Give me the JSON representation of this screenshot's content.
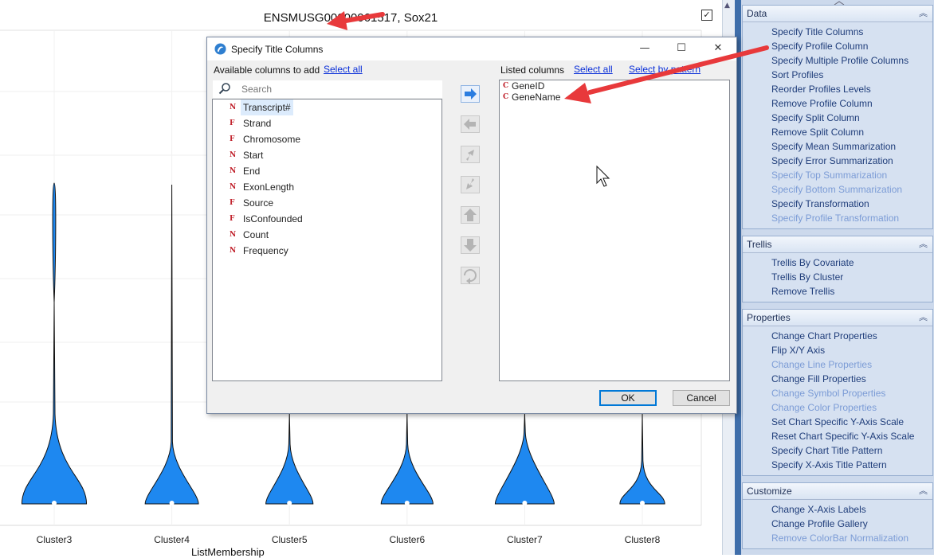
{
  "chart": {
    "title": "ENSMUSG00000061517, Sox21",
    "x_axis_label": "ListMembership",
    "checkbox_mark": "✓"
  },
  "chart_data": {
    "type": "violin",
    "title": "ENSMUSG00000061517, Sox21",
    "xlabel": "ListMembership",
    "categories": [
      "Cluster3",
      "Cluster4",
      "Cluster5",
      "Cluster6",
      "Cluster7",
      "Cluster8"
    ],
    "series": [
      {
        "values": [
          0.62,
          0.38,
          0.25,
          0.35,
          0.5,
          0.2
        ]
      }
    ],
    "fill_color": "#1e88f0",
    "grid": true
  },
  "dialog": {
    "title": "Specify Title Columns",
    "available_label": "Available columns to add",
    "available_select_all": "Select all",
    "listed_label": "Listed columns",
    "listed_select_all": "Select all",
    "listed_select_by_pattern": "Select by pattern",
    "search_placeholder": "Search",
    "available_columns": [
      {
        "type": "N",
        "name": "Transcript#"
      },
      {
        "type": "F",
        "name": "Strand"
      },
      {
        "type": "F",
        "name": "Chromosome"
      },
      {
        "type": "N",
        "name": "Start"
      },
      {
        "type": "N",
        "name": "End"
      },
      {
        "type": "N",
        "name": "ExonLength"
      },
      {
        "type": "F",
        "name": "Source"
      },
      {
        "type": "F",
        "name": "IsConfounded"
      },
      {
        "type": "N",
        "name": "Count"
      },
      {
        "type": "N",
        "name": "Frequency"
      }
    ],
    "listed_columns": [
      {
        "type": "C",
        "name": "GeneID"
      },
      {
        "type": "C",
        "name": "GeneName"
      }
    ],
    "ok_label": "OK",
    "cancel_label": "Cancel",
    "controls": [
      "add-right-icon",
      "remove-left-icon",
      "move-up-left-icon",
      "move-down-right-icon",
      "move-up-icon",
      "move-down-icon",
      "reset-icon"
    ],
    "window_controls": {
      "minimize": "—",
      "maximize": "☐",
      "close": "✕"
    }
  },
  "side_panel": {
    "sections": [
      {
        "title": "Data",
        "items": [
          {
            "label": "Specify Title Columns",
            "enabled": true
          },
          {
            "label": "Specify Profile Column",
            "enabled": true
          },
          {
            "label": "Specify Multiple Profile Columns",
            "enabled": true
          },
          {
            "label": "Sort Profiles",
            "enabled": true
          },
          {
            "label": "Reorder Profiles Levels",
            "enabled": true
          },
          {
            "label": "Remove Profile Column",
            "enabled": true
          },
          {
            "label": "Specify Split Column",
            "enabled": true
          },
          {
            "label": "Remove Split Column",
            "enabled": true
          },
          {
            "label": "Specify Mean Summarization",
            "enabled": true
          },
          {
            "label": "Specify Error Summarization",
            "enabled": true
          },
          {
            "label": "Specify Top Summarization",
            "enabled": false
          },
          {
            "label": "Specify Bottom Summarization",
            "enabled": false
          },
          {
            "label": "Specify Transformation",
            "enabled": true
          },
          {
            "label": "Specify Profile Transformation",
            "enabled": false
          }
        ]
      },
      {
        "title": "Trellis",
        "items": [
          {
            "label": "Trellis By Covariate",
            "enabled": true
          },
          {
            "label": "Trellis By Cluster",
            "enabled": true
          },
          {
            "label": "Remove Trellis",
            "enabled": true
          }
        ]
      },
      {
        "title": "Properties",
        "items": [
          {
            "label": "Change Chart Properties",
            "enabled": true
          },
          {
            "label": "Flip X/Y Axis",
            "enabled": true
          },
          {
            "label": "Change Line Properties",
            "enabled": false
          },
          {
            "label": "Change Fill Properties",
            "enabled": true
          },
          {
            "label": "Change Symbol Properties",
            "enabled": false
          },
          {
            "label": "Change Color Properties",
            "enabled": false
          },
          {
            "label": "Set Chart Specific Y-Axis Scale",
            "enabled": true
          },
          {
            "label": "Reset Chart Specific Y-Axis Scale",
            "enabled": true
          },
          {
            "label": "Specify Chart Title Pattern",
            "enabled": true
          },
          {
            "label": "Specify X-Axis Title Pattern",
            "enabled": true
          }
        ]
      },
      {
        "title": "Customize",
        "items": [
          {
            "label": "Change X-Axis Labels",
            "enabled": true
          },
          {
            "label": "Change Profile Gallery",
            "enabled": true
          },
          {
            "label": "Remove ColorBar Normalization",
            "enabled": false
          }
        ]
      }
    ]
  },
  "colors": {
    "violin_fill": "#1e88f0",
    "annotation_arrow": "#e8393b",
    "panel_bg": "#ccd9ec",
    "link": "#0a2fd8",
    "disabled_item": "#7c9cd6"
  }
}
